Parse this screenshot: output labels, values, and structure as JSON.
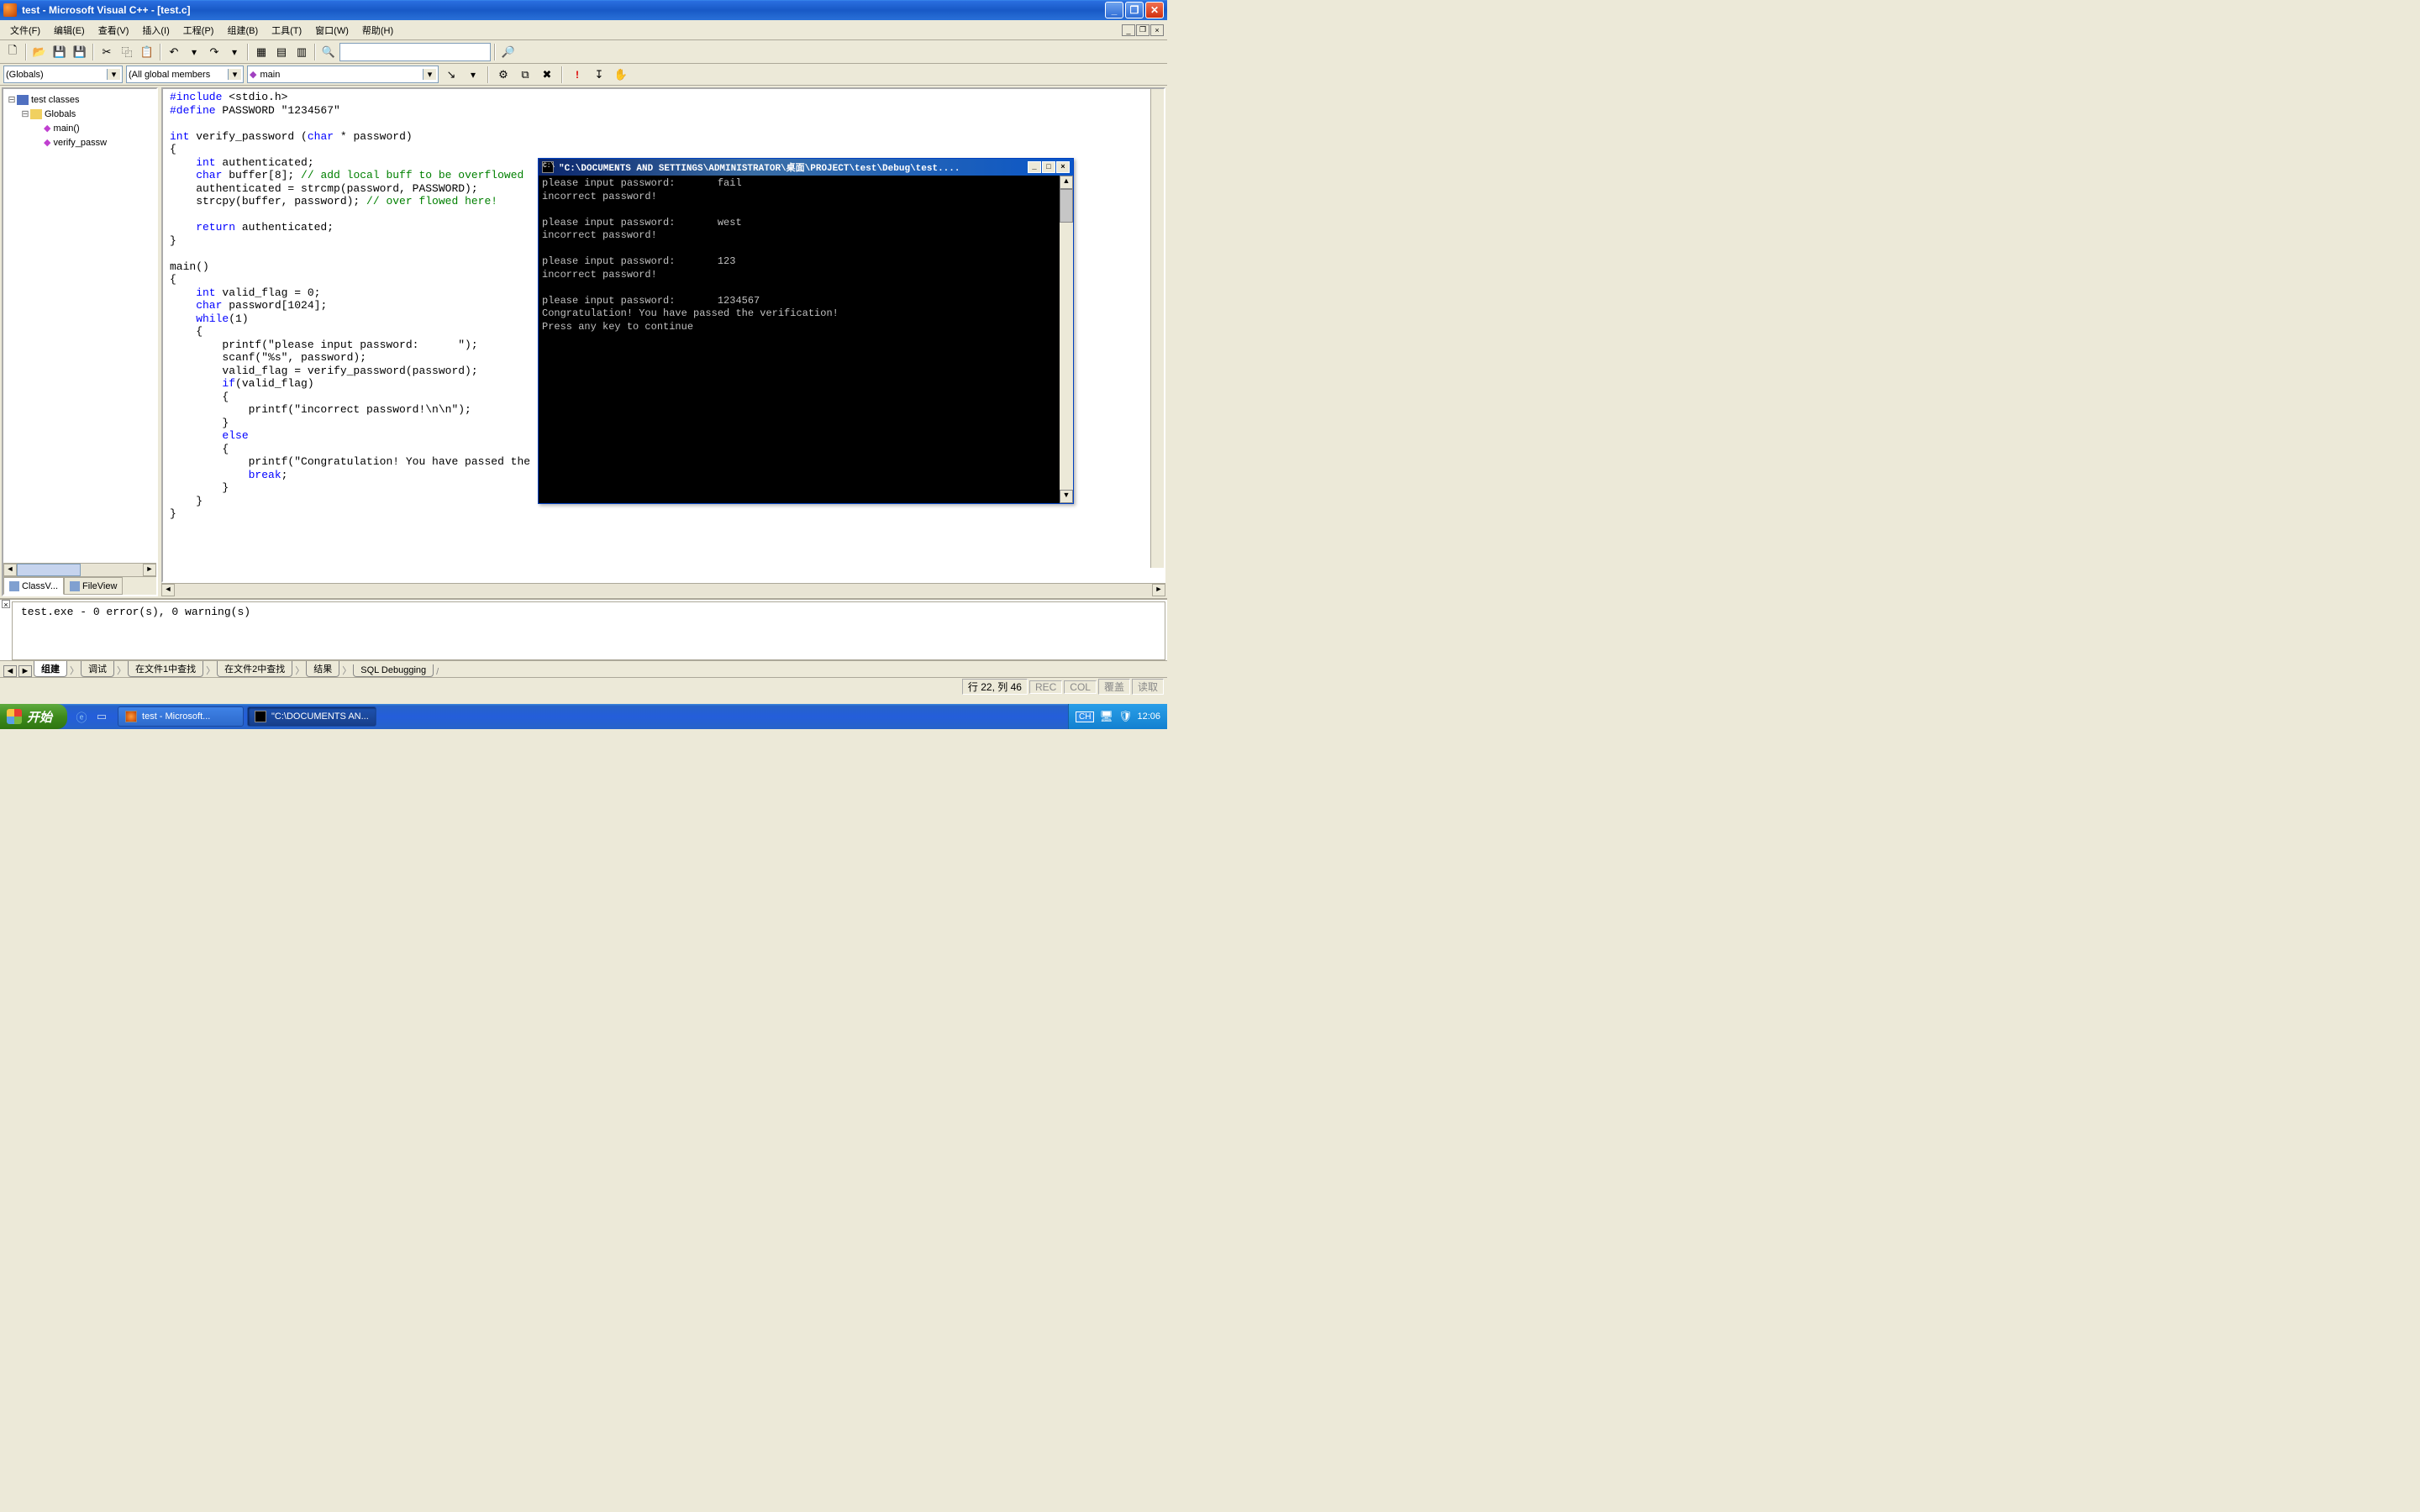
{
  "titlebar": {
    "text": "test - Microsoft Visual C++ - [test.c]"
  },
  "menu": {
    "file": "文件(F)",
    "edit": "编辑(E)",
    "view": "查看(V)",
    "insert": "插入(I)",
    "project": "工程(P)",
    "build": "组建(B)",
    "tools": "工具(T)",
    "window": "窗口(W)",
    "help": "帮助(H)"
  },
  "combos": {
    "scope": "(Globals)",
    "members": "(All global members",
    "func": "main"
  },
  "tree": {
    "root": "test classes",
    "globals": "Globals",
    "main_fn": "main()",
    "verify_fn": "verify_passw"
  },
  "sidebar_tabs": {
    "classview": "ClassV...",
    "fileview": "FileView"
  },
  "code": {
    "l1a": "#include",
    "l1b": " <stdio.h>",
    "l2a": "#define",
    "l2b": " PASSWORD \"1234567\"",
    "l3": "",
    "l4a": "int",
    "l4b": " verify_password (",
    "l4c": "char",
    "l4d": " * password)",
    "l5": "{",
    "l6a": "    int",
    "l6b": " authenticated;",
    "l7a": "    char",
    "l7b": " buffer[8]; ",
    "l7c": "// add local buff to be overflowed",
    "l8": "    authenticated = strcmp(password, PASSWORD);",
    "l9a": "    strcpy(buffer, password); ",
    "l9b": "// over flowed here!",
    "l10": "",
    "l11a": "    return",
    "l11b": " authenticated;",
    "l12": "}",
    "l13": "",
    "l14": "main()",
    "l15": "{",
    "l16a": "    int",
    "l16b": " valid_flag = 0;",
    "l17a": "    char",
    "l17b": " password[1024];",
    "l18a": "    while",
    "l18b": "(1)",
    "l19": "    {",
    "l20": "        printf(\"please input password:      \");",
    "l21": "        scanf(\"%s\", password);",
    "l22": "        valid_flag = verify_password(password);",
    "l23a": "        if",
    "l23b": "(valid_flag)",
    "l24": "        {",
    "l25": "            printf(\"incorrect password!\\n\\n\");",
    "l26": "        }",
    "l27a": "        else",
    "l27b": "",
    "l28": "        {",
    "l29": "            printf(\"Congratulation! You have passed the",
    "l30a": "            break",
    "l30b": ";",
    "l31": "        }",
    "l32": "    }",
    "l33": "}"
  },
  "output": {
    "text": "test.exe - 0 error(s), 0 warning(s)",
    "tabs": {
      "build": "组建",
      "debug": "调试",
      "find1": "在文件1中查找",
      "find2": "在文件2中查找",
      "results": "结果",
      "sql": "SQL Debugging"
    }
  },
  "status": {
    "pos": "行 22, 列 46",
    "rec": "REC",
    "col": "COL",
    "ovr": "覆盖",
    "read": "读取"
  },
  "console": {
    "title": "\"C:\\DOCUMENTS AND SETTINGS\\ADMINISTRATOR\\桌面\\PROJECT\\test\\Debug\\test....",
    "lines": [
      "please input password:       fail",
      "incorrect password!",
      "",
      "please input password:       west",
      "incorrect password!",
      "",
      "please input password:       123",
      "incorrect password!",
      "",
      "please input password:       1234567",
      "Congratulation! You have passed the verification!",
      "Press any key to continue"
    ]
  },
  "taskbar": {
    "start": "开始",
    "task_vc": "test - Microsoft...",
    "task_console": "\"C:\\DOCUMENTS AN...",
    "lang": "CH",
    "clock": "12:06"
  }
}
